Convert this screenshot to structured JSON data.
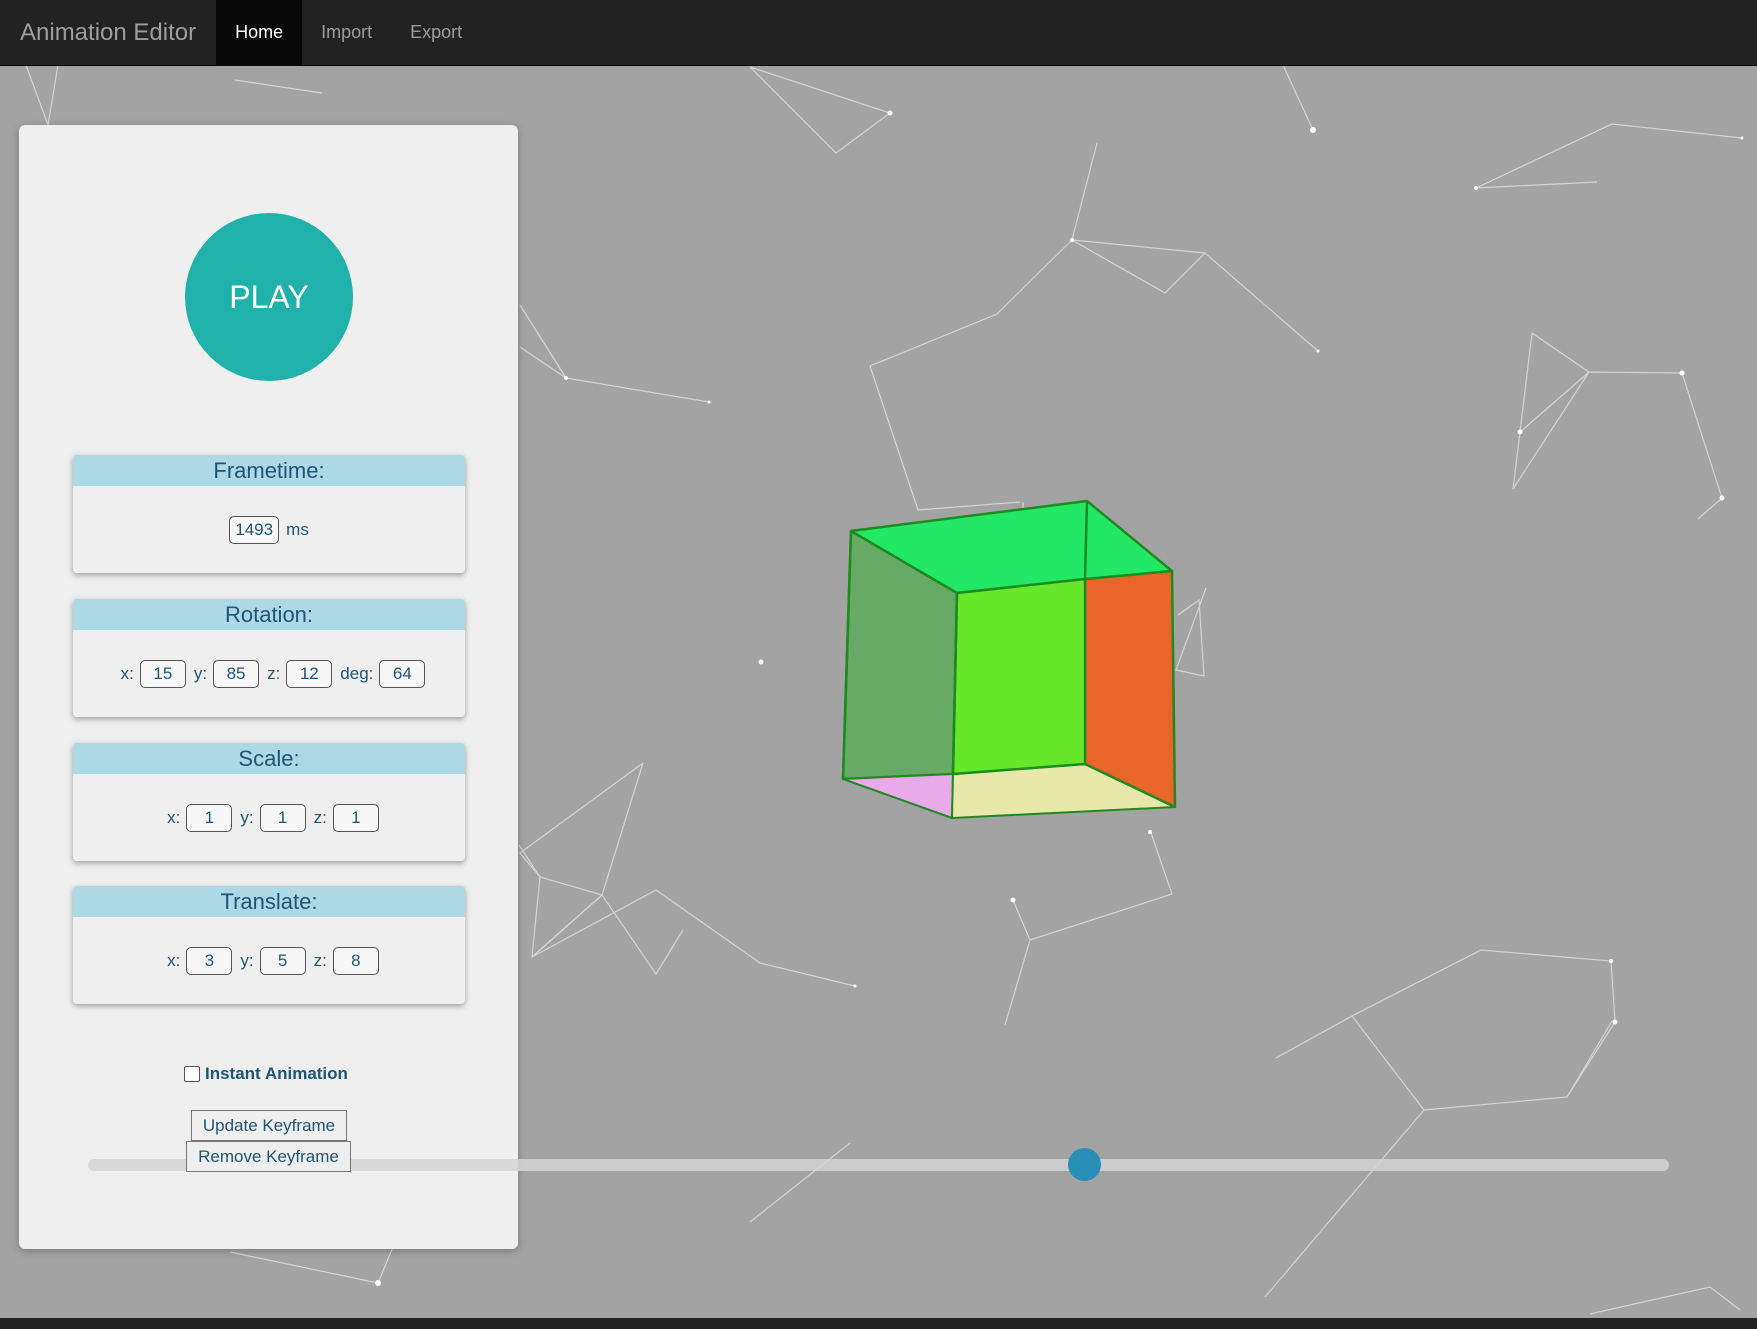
{
  "navbar": {
    "brand": "Animation Editor",
    "items": [
      {
        "label": "Home",
        "active": true
      },
      {
        "label": "Import",
        "active": false
      },
      {
        "label": "Export",
        "active": false
      }
    ]
  },
  "panel": {
    "play_label": "PLAY",
    "frametime": {
      "title": "Frametime:",
      "value": "1493",
      "unit": "ms"
    },
    "rotation": {
      "title": "Rotation:",
      "x_label": "x:",
      "x": "15",
      "y_label": "y:",
      "y": "85",
      "z_label": "z:",
      "z": "12",
      "deg_label": "deg:",
      "deg": "64"
    },
    "scale": {
      "title": "Scale:",
      "x_label": "x:",
      "x": "1",
      "y_label": "y:",
      "y": "1",
      "z_label": "z:",
      "z": "1"
    },
    "translate": {
      "title": "Translate:",
      "x_label": "x:",
      "x": "3",
      "y_label": "y:",
      "y": "5",
      "z_label": "z:",
      "z": "8"
    },
    "instant_animation": {
      "label": "Instant Animation",
      "checked": false
    },
    "update_button": "Update Keyframe",
    "remove_button": "Remove Keyframe"
  },
  "timeline": {
    "position": 0.63
  },
  "colors": {
    "accent": "#20b2aa",
    "card_header": "#add8e6",
    "slider_thumb": "#2a8fb8",
    "cube_top": "#22e866",
    "cube_front": "#66e82a",
    "cube_right": "#e8662a",
    "cube_left": "#66aa66",
    "cube_bottom": "#e8e8aa",
    "cube_bottom_left": "#e8aae8",
    "cube_back_right": "#aa6666"
  }
}
